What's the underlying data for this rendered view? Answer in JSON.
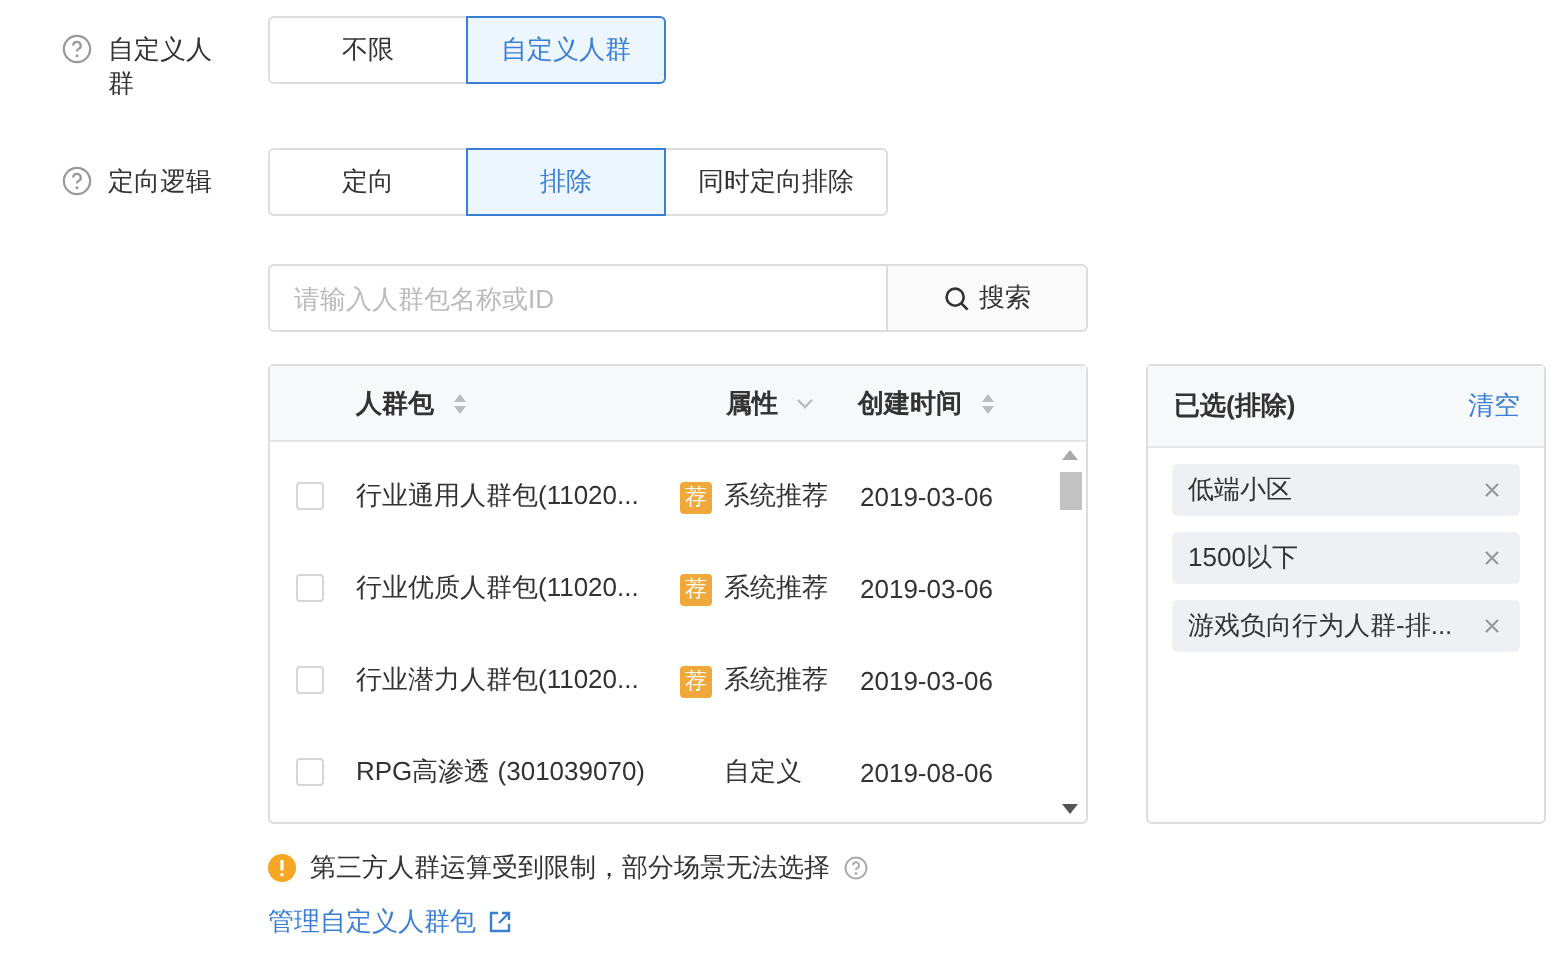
{
  "fields": [
    {
      "label": "自定义人群",
      "options": [
        {
          "label": "不限",
          "selected": false
        },
        {
          "label": "自定义人群",
          "selected": true
        }
      ]
    },
    {
      "label": "定向逻辑",
      "options": [
        {
          "label": "定向",
          "selected": false
        },
        {
          "label": "排除",
          "selected": true
        },
        {
          "label": "同时定向排除",
          "selected": false
        }
      ]
    }
  ],
  "search": {
    "placeholder": "请输入人群包名称或ID",
    "button": "搜索"
  },
  "table": {
    "columns": [
      {
        "label": "人群包",
        "kind": "sort"
      },
      {
        "label": "属性",
        "kind": "filter"
      },
      {
        "label": "创建时间",
        "kind": "sort"
      }
    ],
    "rows": [
      {
        "checked": false,
        "name": "行业通用人群包(11020...",
        "badge": "荐",
        "attribute": "系统推荐",
        "created": "2019-03-06"
      },
      {
        "checked": false,
        "name": "行业优质人群包(11020...",
        "badge": "荐",
        "attribute": "系统推荐",
        "created": "2019-03-06"
      },
      {
        "checked": false,
        "name": "行业潜力人群包(11020...",
        "badge": "荐",
        "attribute": "系统推荐",
        "created": "2019-03-06"
      },
      {
        "checked": false,
        "name": "RPG高渗透 (301039070)",
        "attribute": "自定义",
        "created": "2019-08-06"
      }
    ]
  },
  "selected_panel": {
    "title": "已选(排除)",
    "clear": "清空",
    "items": [
      "低端小区",
      "1500以下",
      "游戏负向行为人群-排..."
    ]
  },
  "notice": "第三方人群运算受到限制，部分场景无法选择",
  "manage_link": "管理自定义人群包"
}
